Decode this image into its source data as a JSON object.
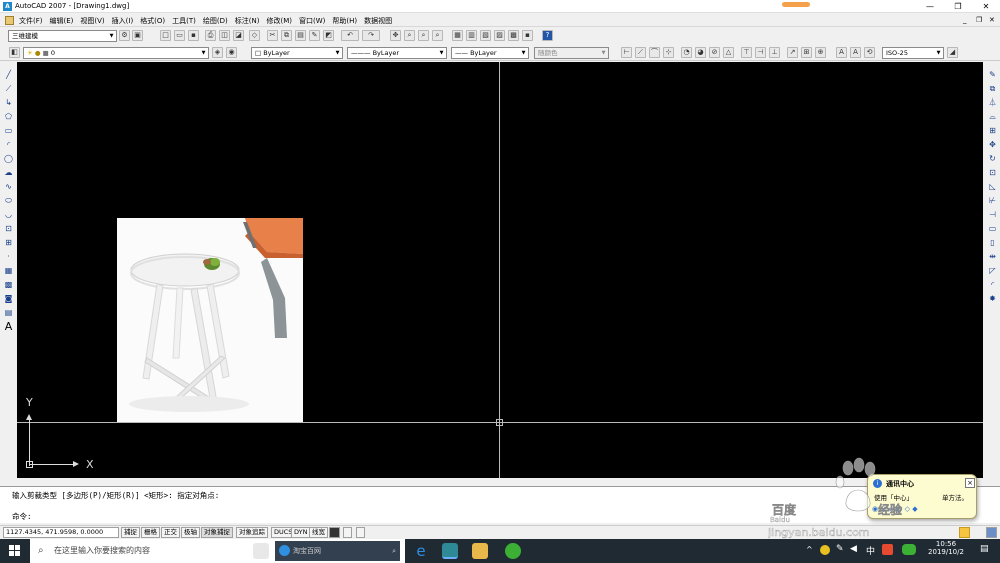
{
  "window": {
    "title": "AutoCAD 2007 - [Drawing1.dwg]",
    "buttons": {
      "minimize": "—",
      "restore": "❐",
      "close": "✕"
    }
  },
  "menu": {
    "items": [
      "文件(F)",
      "编辑(E)",
      "视图(V)",
      "插入(I)",
      "格式(O)",
      "工具(T)",
      "绘图(D)",
      "标注(N)",
      "修改(M)",
      "窗口(W)",
      "帮助(H)",
      "数据视图"
    ],
    "doc_minimize": "_",
    "doc_restore": "❐",
    "doc_close": "✕"
  },
  "workspace": {
    "value": "三维建模"
  },
  "layer": {
    "value": "0"
  },
  "properties": {
    "color": "ByLayer",
    "linetype": "ByLayer",
    "lineweight": "ByLayer",
    "plotstyle": "随颜色"
  },
  "dimstyle": {
    "value": "ISO-25"
  },
  "ucs": {
    "x_label": "X",
    "y_label": "Y"
  },
  "command": {
    "history_line": "输入剪裁类型 [多边形(P)/矩形(R)] <矩形>: 指定对角点:",
    "prompt": "命令:"
  },
  "status": {
    "coordinates": "1127.4345, 471.9598, 0.0000",
    "toggles": [
      "捕捉",
      "栅格",
      "正交",
      "极轴",
      "对象捕捉",
      "对象追踪",
      "DUCS",
      "DYN",
      "线宽"
    ]
  },
  "notification": {
    "title": "通讯中心",
    "body": "使用「中心」",
    "tail": "单方法。"
  },
  "taskbar": {
    "search_placeholder": "在这里输入你要搜索的内容",
    "browser_tab": "淘宝百网",
    "time": "10:56",
    "date": "2019/10/2",
    "ime": "中"
  },
  "watermark": {
    "text": "jingyan.baidu.com"
  },
  "colors": {
    "canvas": "#000000",
    "taskbar": "#1f2a33",
    "accent": "#1e88c8"
  }
}
